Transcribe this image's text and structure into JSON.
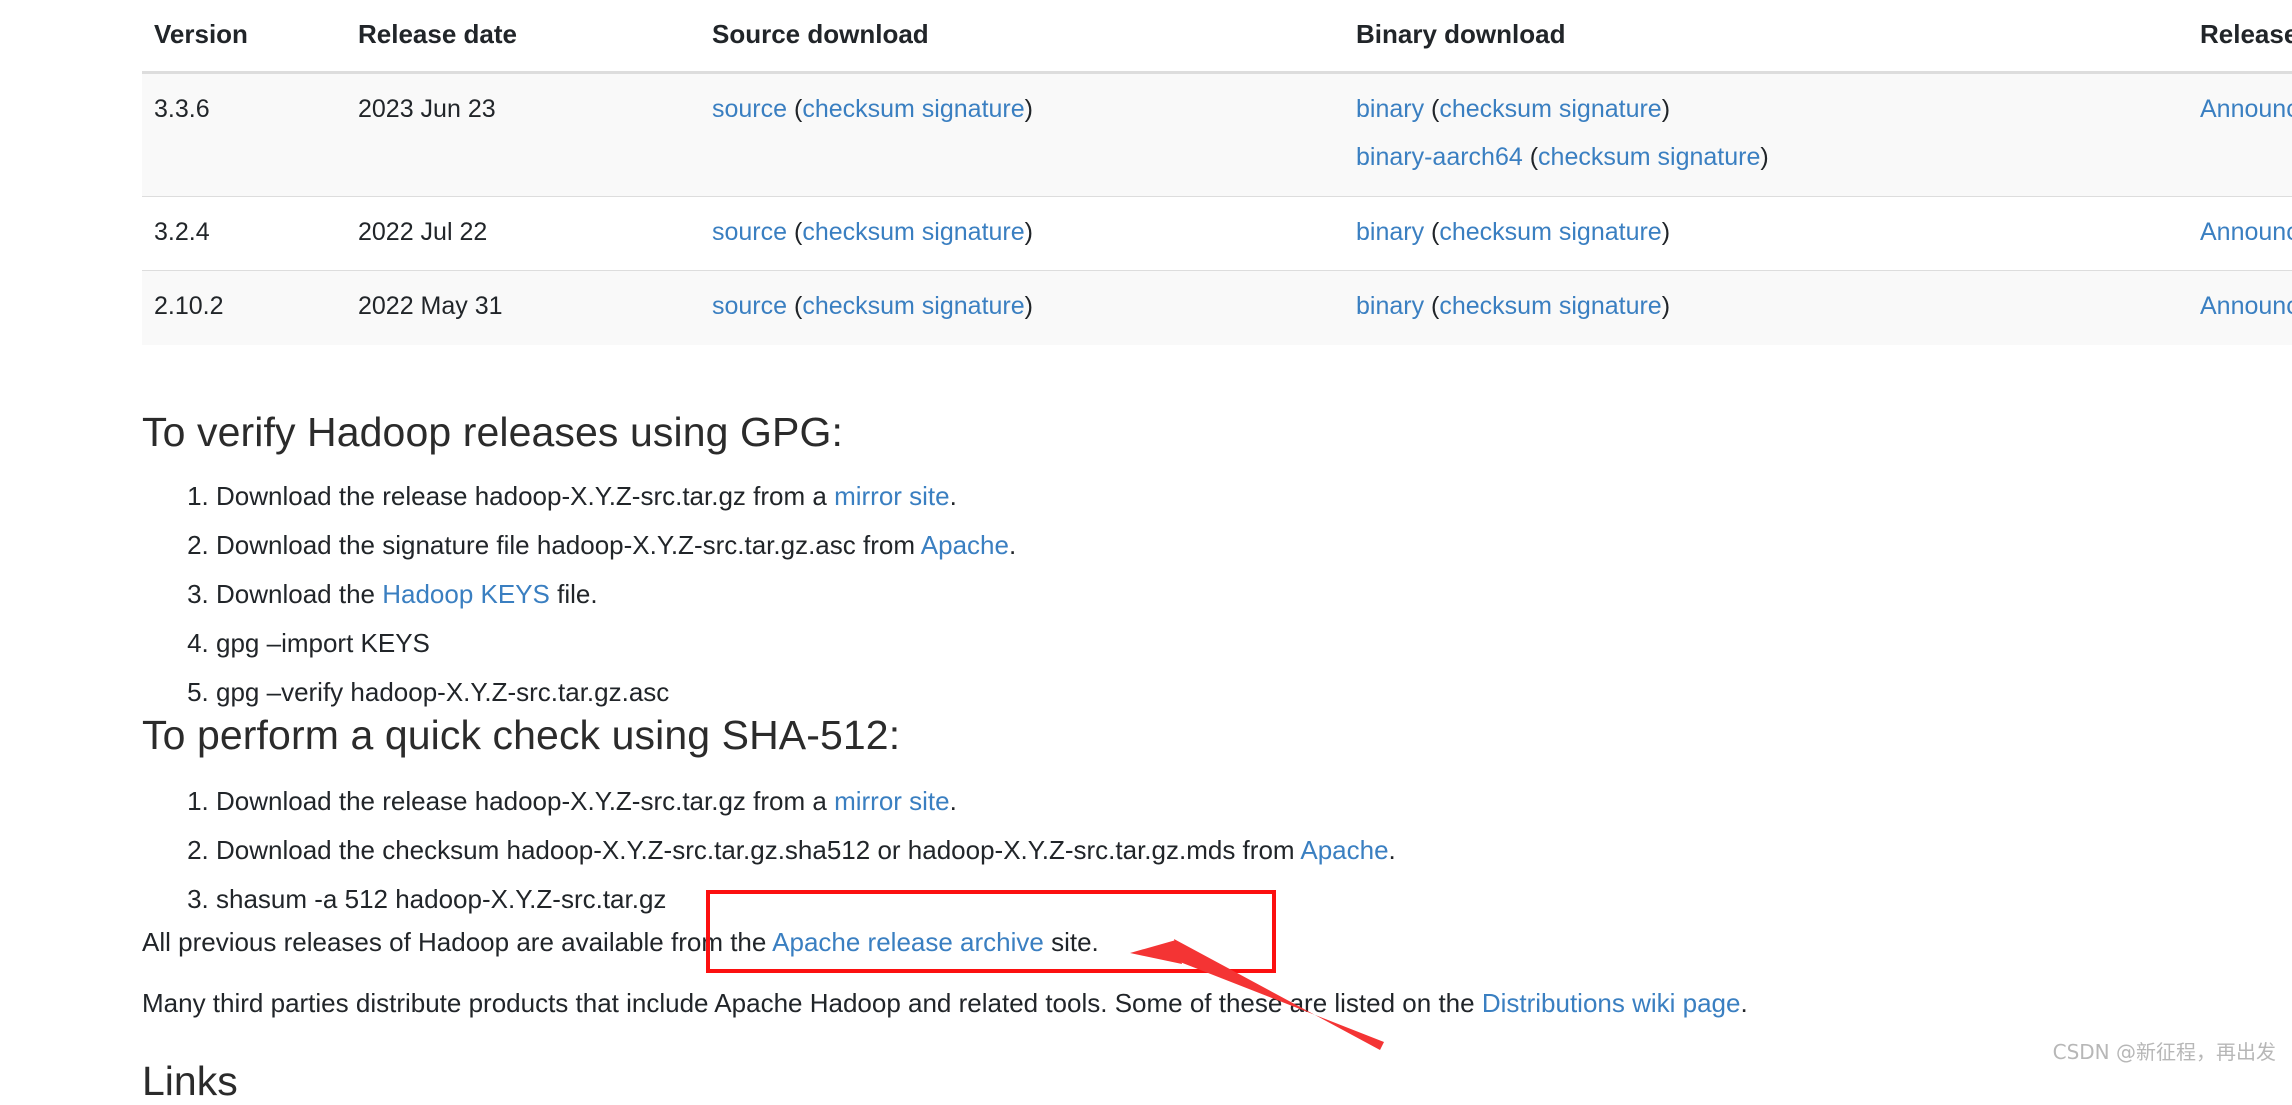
{
  "table": {
    "columns": [
      "Version",
      "Release date",
      "Source download",
      "Binary download",
      "Release notes"
    ],
    "rows": [
      {
        "version": "3.3.6",
        "date": "2023 Jun 23",
        "source": [
          {
            "link": "source",
            "open": " (",
            "checksum": "checksum signature",
            "close": ")"
          }
        ],
        "binary": [
          {
            "link": "binary",
            "open": " (",
            "checksum": "checksum signature",
            "close": ")"
          },
          {
            "link": "binary-aarch64",
            "open": " (",
            "checksum": "checksum signature",
            "close": ")"
          }
        ],
        "notes": "Announcement"
      },
      {
        "version": "3.2.4",
        "date": "2022 Jul 22",
        "source": [
          {
            "link": "source",
            "open": " (",
            "checksum": "checksum signature",
            "close": ")"
          }
        ],
        "binary": [
          {
            "link": "binary",
            "open": " (",
            "checksum": "checksum signature",
            "close": ")"
          }
        ],
        "notes": "Announcement"
      },
      {
        "version": "2.10.2",
        "date": "2022 May 31",
        "source": [
          {
            "link": "source",
            "open": " (",
            "checksum": "checksum signature",
            "close": ")"
          }
        ],
        "binary": [
          {
            "link": "binary",
            "open": " (",
            "checksum": "checksum signature",
            "close": ")"
          }
        ],
        "notes": "Announcement"
      }
    ]
  },
  "gpg": {
    "heading": "To verify Hadoop releases using GPG:",
    "steps": [
      {
        "pre": "Download the release hadoop-X.Y.Z-src.tar.gz from a ",
        "link": "mirror site",
        "post": "."
      },
      {
        "pre": "Download the signature file hadoop-X.Y.Z-src.tar.gz.asc from ",
        "link": "Apache",
        "post": "."
      },
      {
        "pre": "Download the ",
        "link": "Hadoop KEYS",
        "post": " file."
      },
      {
        "pre": "gpg –import KEYS",
        "link": "",
        "post": ""
      },
      {
        "pre": "gpg –verify hadoop-X.Y.Z-src.tar.gz.asc",
        "link": "",
        "post": ""
      }
    ]
  },
  "sha": {
    "heading": "To perform a quick check using SHA-512:",
    "steps": [
      {
        "pre": "Download the release hadoop-X.Y.Z-src.tar.gz from a ",
        "link": "mirror site",
        "post": "."
      },
      {
        "pre": "Download the checksum hadoop-X.Y.Z-src.tar.gz.sha512 or hadoop-X.Y.Z-src.tar.gz.mds from ",
        "link": "Apache",
        "post": "."
      },
      {
        "pre": "shasum -a 512 hadoop-X.Y.Z-src.tar.gz",
        "link": "",
        "post": ""
      }
    ]
  },
  "paragraphs": {
    "archive": {
      "pre": "All previous releases of Hadoop are available from the ",
      "link": "Apache release archive",
      "post": " site."
    },
    "third_party": {
      "pre": "Many third parties distribute products that include Apache Hadoop and related tools. Some of these are listed on the ",
      "link": "Distributions wiki page",
      "post": "."
    }
  },
  "clipped_heading": "Links",
  "watermark": "CSDN @新征程，再出发",
  "colors": {
    "link": "#3a7fc1",
    "annotation": "#fc1010",
    "row_alt_bg": "#f9f9f9",
    "border": "#dddddd",
    "text": "#212529",
    "watermark": "#b7b7b7"
  }
}
